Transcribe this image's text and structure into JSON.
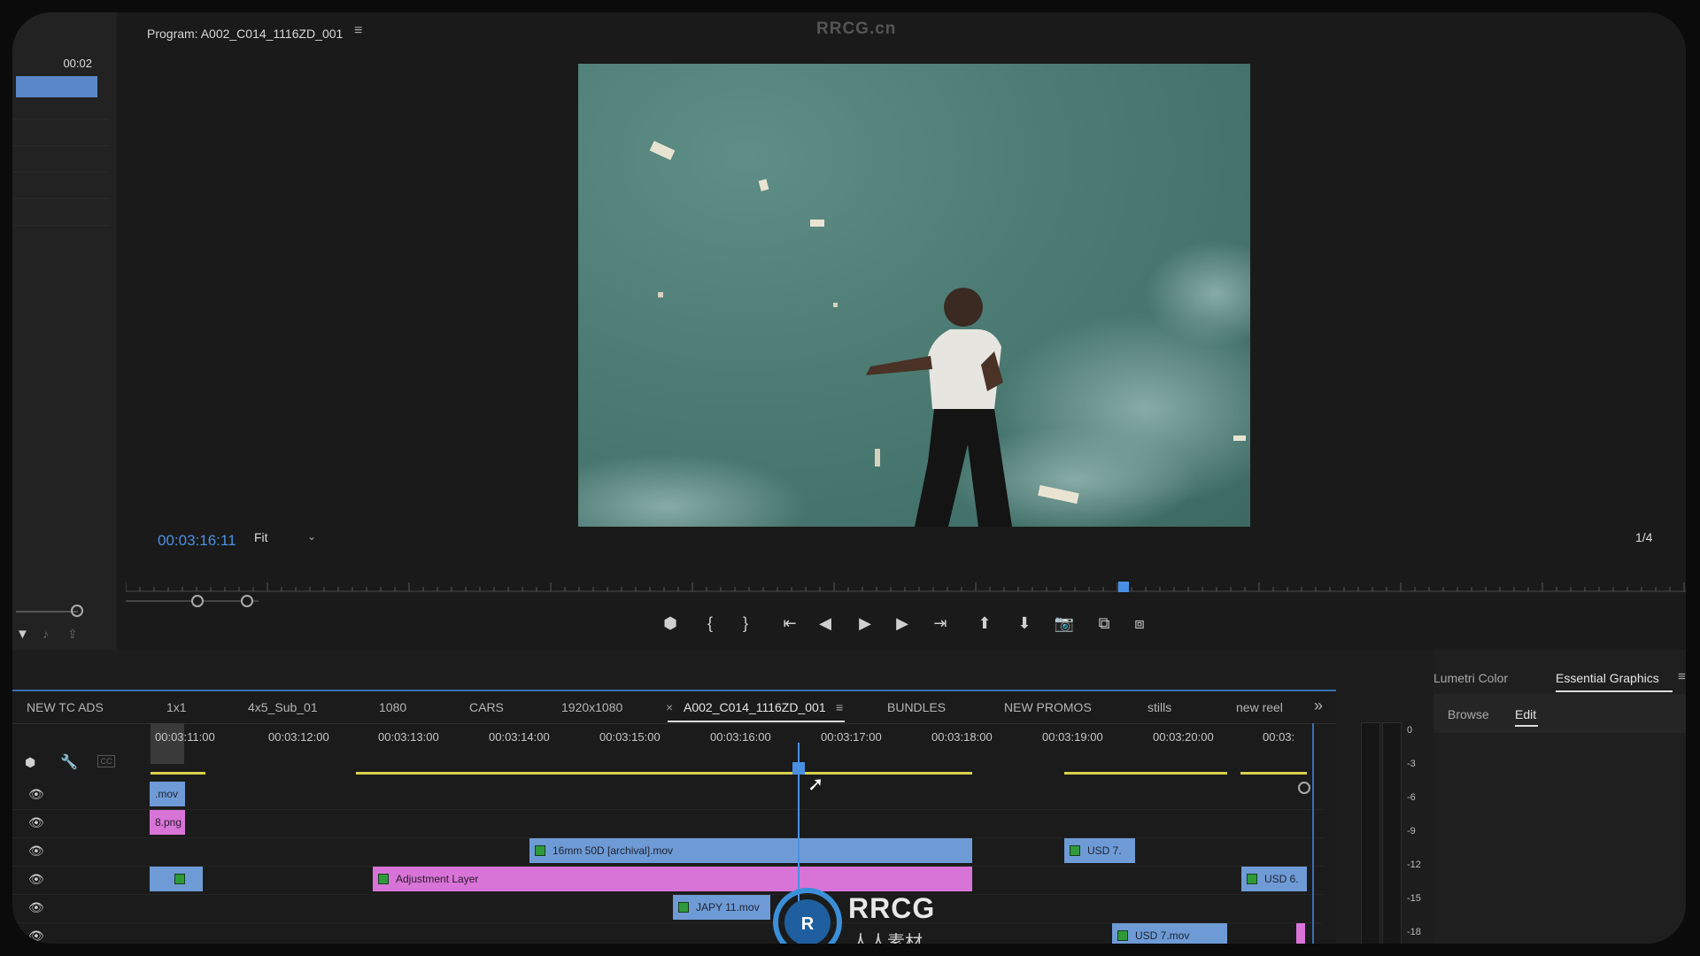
{
  "watermark": "RRCG.cn",
  "left_panel": {
    "timecode": "00:02"
  },
  "program": {
    "title": "Program: A002_C014_1116ZD_001",
    "menu_icon": "hamburger-icon",
    "timecode": "00:03:16:11",
    "fit_label": "Fit",
    "resolution_label": "1/4"
  },
  "controls": [
    {
      "name": "add-marker-button",
      "glyph": "⬢"
    },
    {
      "name": "mark-in-button",
      "glyph": "{"
    },
    {
      "name": "mark-out-button",
      "glyph": "}"
    },
    {
      "name": "go-to-in-button",
      "glyph": "⇤"
    },
    {
      "name": "step-back-button",
      "glyph": "◀"
    },
    {
      "name": "play-button",
      "glyph": "▶"
    },
    {
      "name": "step-forward-button",
      "glyph": "▶"
    },
    {
      "name": "go-to-out-button",
      "glyph": "⇥"
    },
    {
      "name": "lift-button",
      "glyph": "⬆"
    },
    {
      "name": "extract-button",
      "glyph": "⬇"
    },
    {
      "name": "export-frame-button",
      "glyph": "📷"
    },
    {
      "name": "comparison-view-button",
      "glyph": "⧉"
    },
    {
      "name": "proxy-toggle-button",
      "glyph": "⧈"
    }
  ],
  "timeline": {
    "tabs": [
      {
        "label": "NEW TC ADS",
        "active": false
      },
      {
        "label": "1x1",
        "active": false
      },
      {
        "label": "4x5_Sub_01",
        "active": false
      },
      {
        "label": "1080",
        "active": false
      },
      {
        "label": "CARS",
        "active": false
      },
      {
        "label": "1920x1080",
        "active": false
      },
      {
        "label": "A002_C014_1116ZD_001",
        "active": true
      },
      {
        "label": "BUNDLES",
        "active": false
      },
      {
        "label": "NEW PROMOS",
        "active": false
      },
      {
        "label": "stills",
        "active": false
      },
      {
        "label": "new reel",
        "active": false
      }
    ],
    "close_glyph": "×",
    "tab_menu_glyph": "≡",
    "overflow_glyph": "»",
    "ruler_labels": [
      "00:03:11:00",
      "00:03:12:00",
      "00:03:13:00",
      "00:03:14:00",
      "00:03:15:00",
      "00:03:16:00",
      "00:03:17:00",
      "00:03:18:00",
      "00:03:19:00",
      "00:03:20:00",
      "00:03:"
    ],
    "clips": {
      "v6_left": ".mov",
      "v5_left": "8.png",
      "archival": "16mm 50D [archival].mov",
      "usd7_short": "USD 7.",
      "adjustment": "Adjustment Layer",
      "usd6": "USD 6.",
      "japy": "JAPY 11.mov",
      "usd7": "USD 7.mov"
    }
  },
  "right_panel": {
    "tab_lumetri": "Lumetri Color",
    "tab_essential": "Essential Graphics",
    "sub_browse": "Browse",
    "sub_edit": "Edit"
  },
  "meter_labels": [
    "0",
    "-3",
    "-6",
    "-9",
    "-12",
    "-15",
    "-18"
  ],
  "logo": {
    "letters": "RRCG",
    "sub": "人人素材"
  },
  "colors": {
    "accent_blue": "#4a90e2",
    "clip_blue": "#6e9bd6",
    "clip_pink": "#d874d8",
    "in_out_yellow": "#d8d04a"
  }
}
